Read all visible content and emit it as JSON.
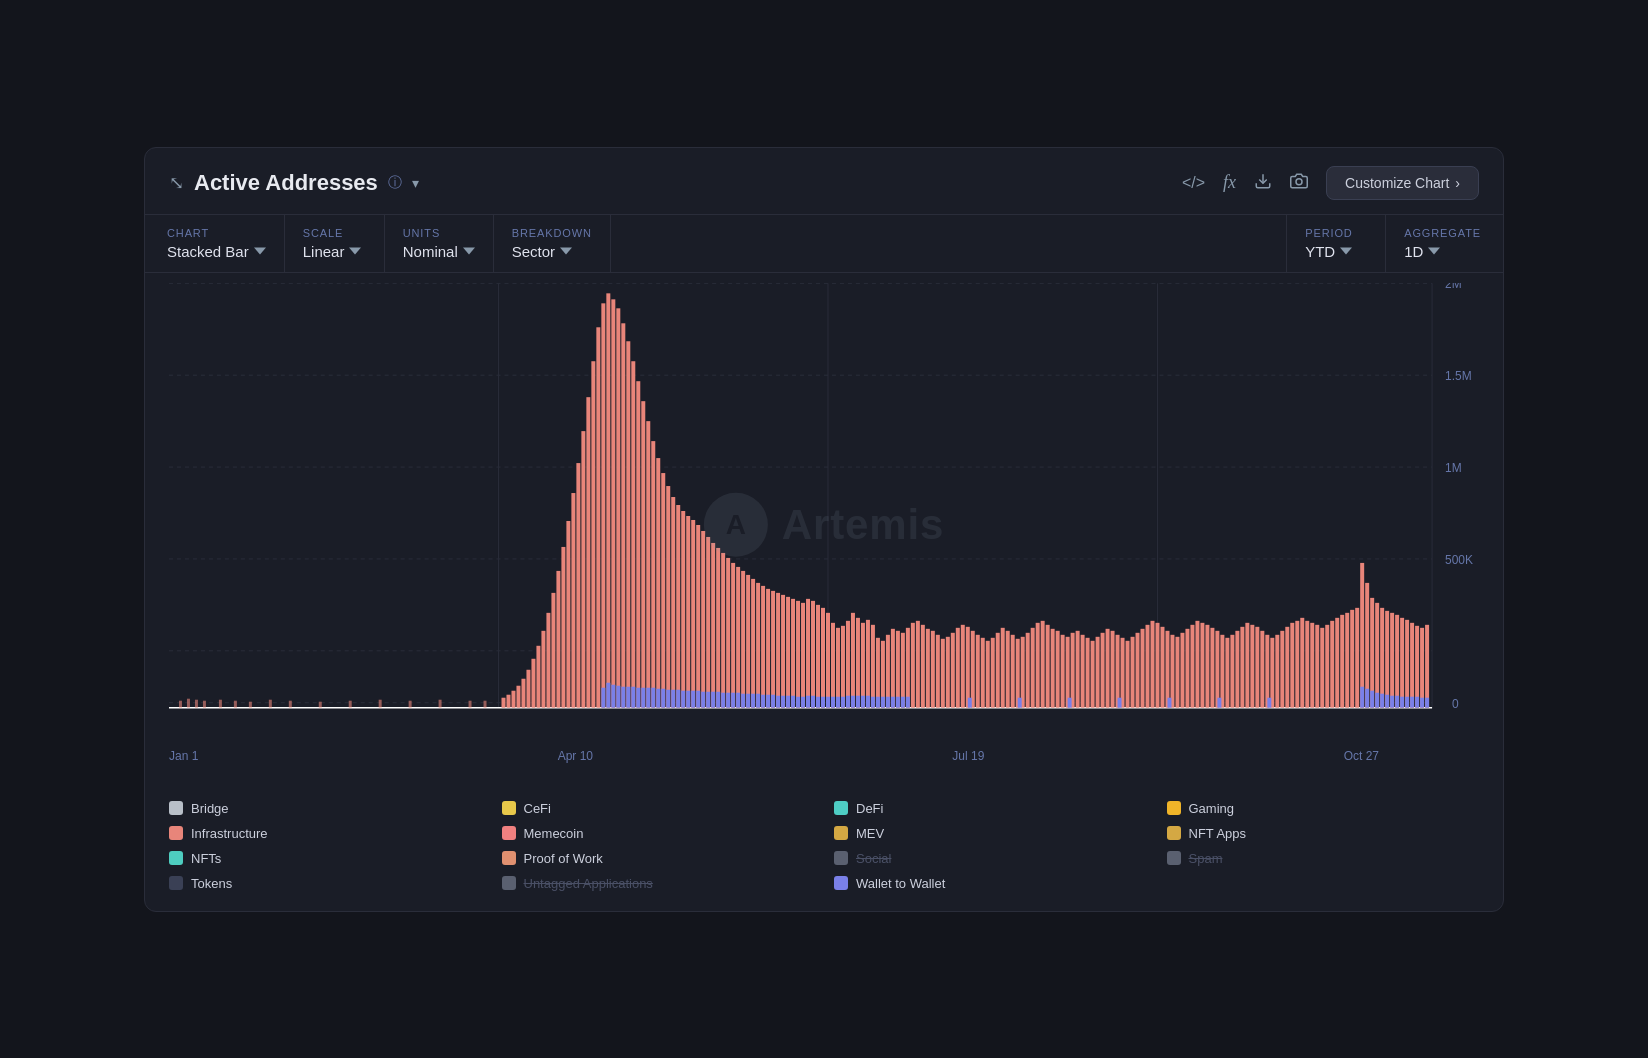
{
  "header": {
    "title": "Active Addresses",
    "info_icon": "ⓘ",
    "chevron": "▾",
    "actions": [
      {
        "name": "code-icon",
        "label": "</>"
      },
      {
        "name": "formula-icon",
        "label": "𝑓𝑥"
      },
      {
        "name": "download-icon",
        "label": "⬇"
      },
      {
        "name": "camera-icon",
        "label": "📷"
      }
    ],
    "customize_btn": "Customize Chart",
    "customize_chevron": "›"
  },
  "controls": [
    {
      "id": "chart",
      "label": "CHART",
      "value": "Stacked Bar"
    },
    {
      "id": "scale",
      "label": "SCALE",
      "value": "Linear"
    },
    {
      "id": "units",
      "label": "UNITS",
      "value": "Nominal"
    },
    {
      "id": "breakdown",
      "label": "BREAKDOWN",
      "value": "Sector"
    },
    {
      "id": "period",
      "label": "PERIOD",
      "value": "YTD"
    },
    {
      "id": "aggregate",
      "label": "AGGREGATE",
      "value": "1D"
    }
  ],
  "chart": {
    "y_labels": [
      "2M",
      "1.5M",
      "1M",
      "500K",
      "0"
    ],
    "x_labels": [
      "Jan 1",
      "Apr 10",
      "Jul 19",
      "Oct 27"
    ]
  },
  "legend": [
    {
      "id": "bridge",
      "color": "#b8bfc8",
      "label": "Bridge",
      "disabled": false
    },
    {
      "id": "cefi",
      "color": "#e8c84a",
      "label": "CeFi",
      "disabled": false
    },
    {
      "id": "defi",
      "color": "#4ecdc4",
      "label": "DeFi",
      "disabled": false
    },
    {
      "id": "gaming",
      "color": "#f0b429",
      "label": "Gaming",
      "disabled": false
    },
    {
      "id": "infrastructure",
      "color": "#e8857a",
      "label": "Infrastructure",
      "disabled": false
    },
    {
      "id": "memecoin",
      "color": "#f08080",
      "label": "Memecoin",
      "disabled": false
    },
    {
      "id": "mev",
      "color": "#d4a843",
      "label": "MEV",
      "disabled": false
    },
    {
      "id": "nft-apps",
      "color": "#d4a843",
      "label": "NFT Apps",
      "disabled": false
    },
    {
      "id": "nfts",
      "color": "#4ecdc0",
      "label": "NFTs",
      "disabled": false
    },
    {
      "id": "proof-of-work",
      "color": "#e09070",
      "label": "Proof of Work",
      "disabled": false
    },
    {
      "id": "social",
      "color": "#5a6070",
      "label": "Social",
      "disabled": true
    },
    {
      "id": "spam",
      "color": "#5a6070",
      "label": "Spam",
      "disabled": true
    },
    {
      "id": "tokens",
      "color": "#3a4055",
      "label": "Tokens",
      "disabled": false
    },
    {
      "id": "untagged-applications",
      "color": "#5a6070",
      "label": "Untagged Applications",
      "disabled": true
    },
    {
      "id": "wallet-to-wallet",
      "color": "#7a80e8",
      "label": "Wallet to Wallet",
      "disabled": false
    }
  ],
  "watermark": {
    "text": "Artemis"
  }
}
